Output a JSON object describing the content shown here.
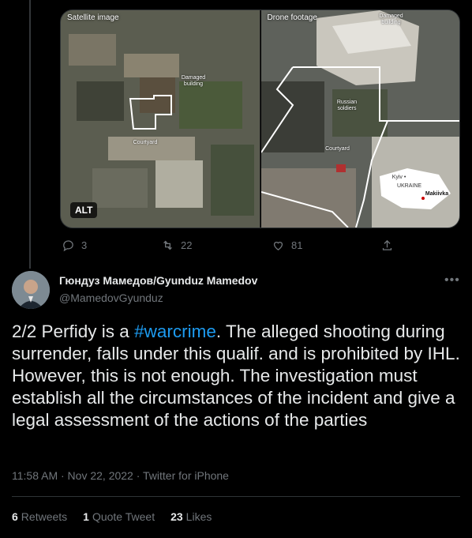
{
  "media": {
    "left_label": "Satellite image",
    "right_label": "Drone footage",
    "sat_damaged": "Damaged building",
    "sat_courtyard": "Courtyard",
    "drone_damaged": "Damaged building",
    "drone_soldiers": "Russian soldiers",
    "drone_courtyard": "Courtyard",
    "inset_kyiv": "Kyiv •",
    "inset_country": "UKRAINE",
    "inset_town": "Makiivka",
    "alt_label": "ALT"
  },
  "actions": {
    "replies": "3",
    "retweets": "22",
    "likes": "81"
  },
  "tweet": {
    "name": "Гюндуз Мамедов/Gyunduz Mamedov",
    "handle": "@MamedovGyunduz",
    "text_1": "2/2 Perfidy is a ",
    "hashtag": "#warcrime",
    "text_2": ". The alleged shooting during surrender, falls under this qualif. and is prohibited by IHL.",
    "text_3": "However, this is not enough. The  investigation must establish all the circumstances of the incident and give a legal assessment of the actions of the parties",
    "meta": "11:58 AM · Nov 22, 2022 · Twitter for iPhone"
  },
  "stats": {
    "retweets_count": "6",
    "retweets_label": "Retweets",
    "quotes_count": "1",
    "quotes_label": "Quote Tweet",
    "likes_count": "23",
    "likes_label": "Likes"
  },
  "colors": {
    "accent": "#1d9bf0",
    "muted": "#71767b",
    "text": "#e7e9ea",
    "background": "#000000"
  },
  "icons": [
    "reply-icon",
    "retweet-icon",
    "like-icon",
    "share-icon",
    "more-icon"
  ]
}
